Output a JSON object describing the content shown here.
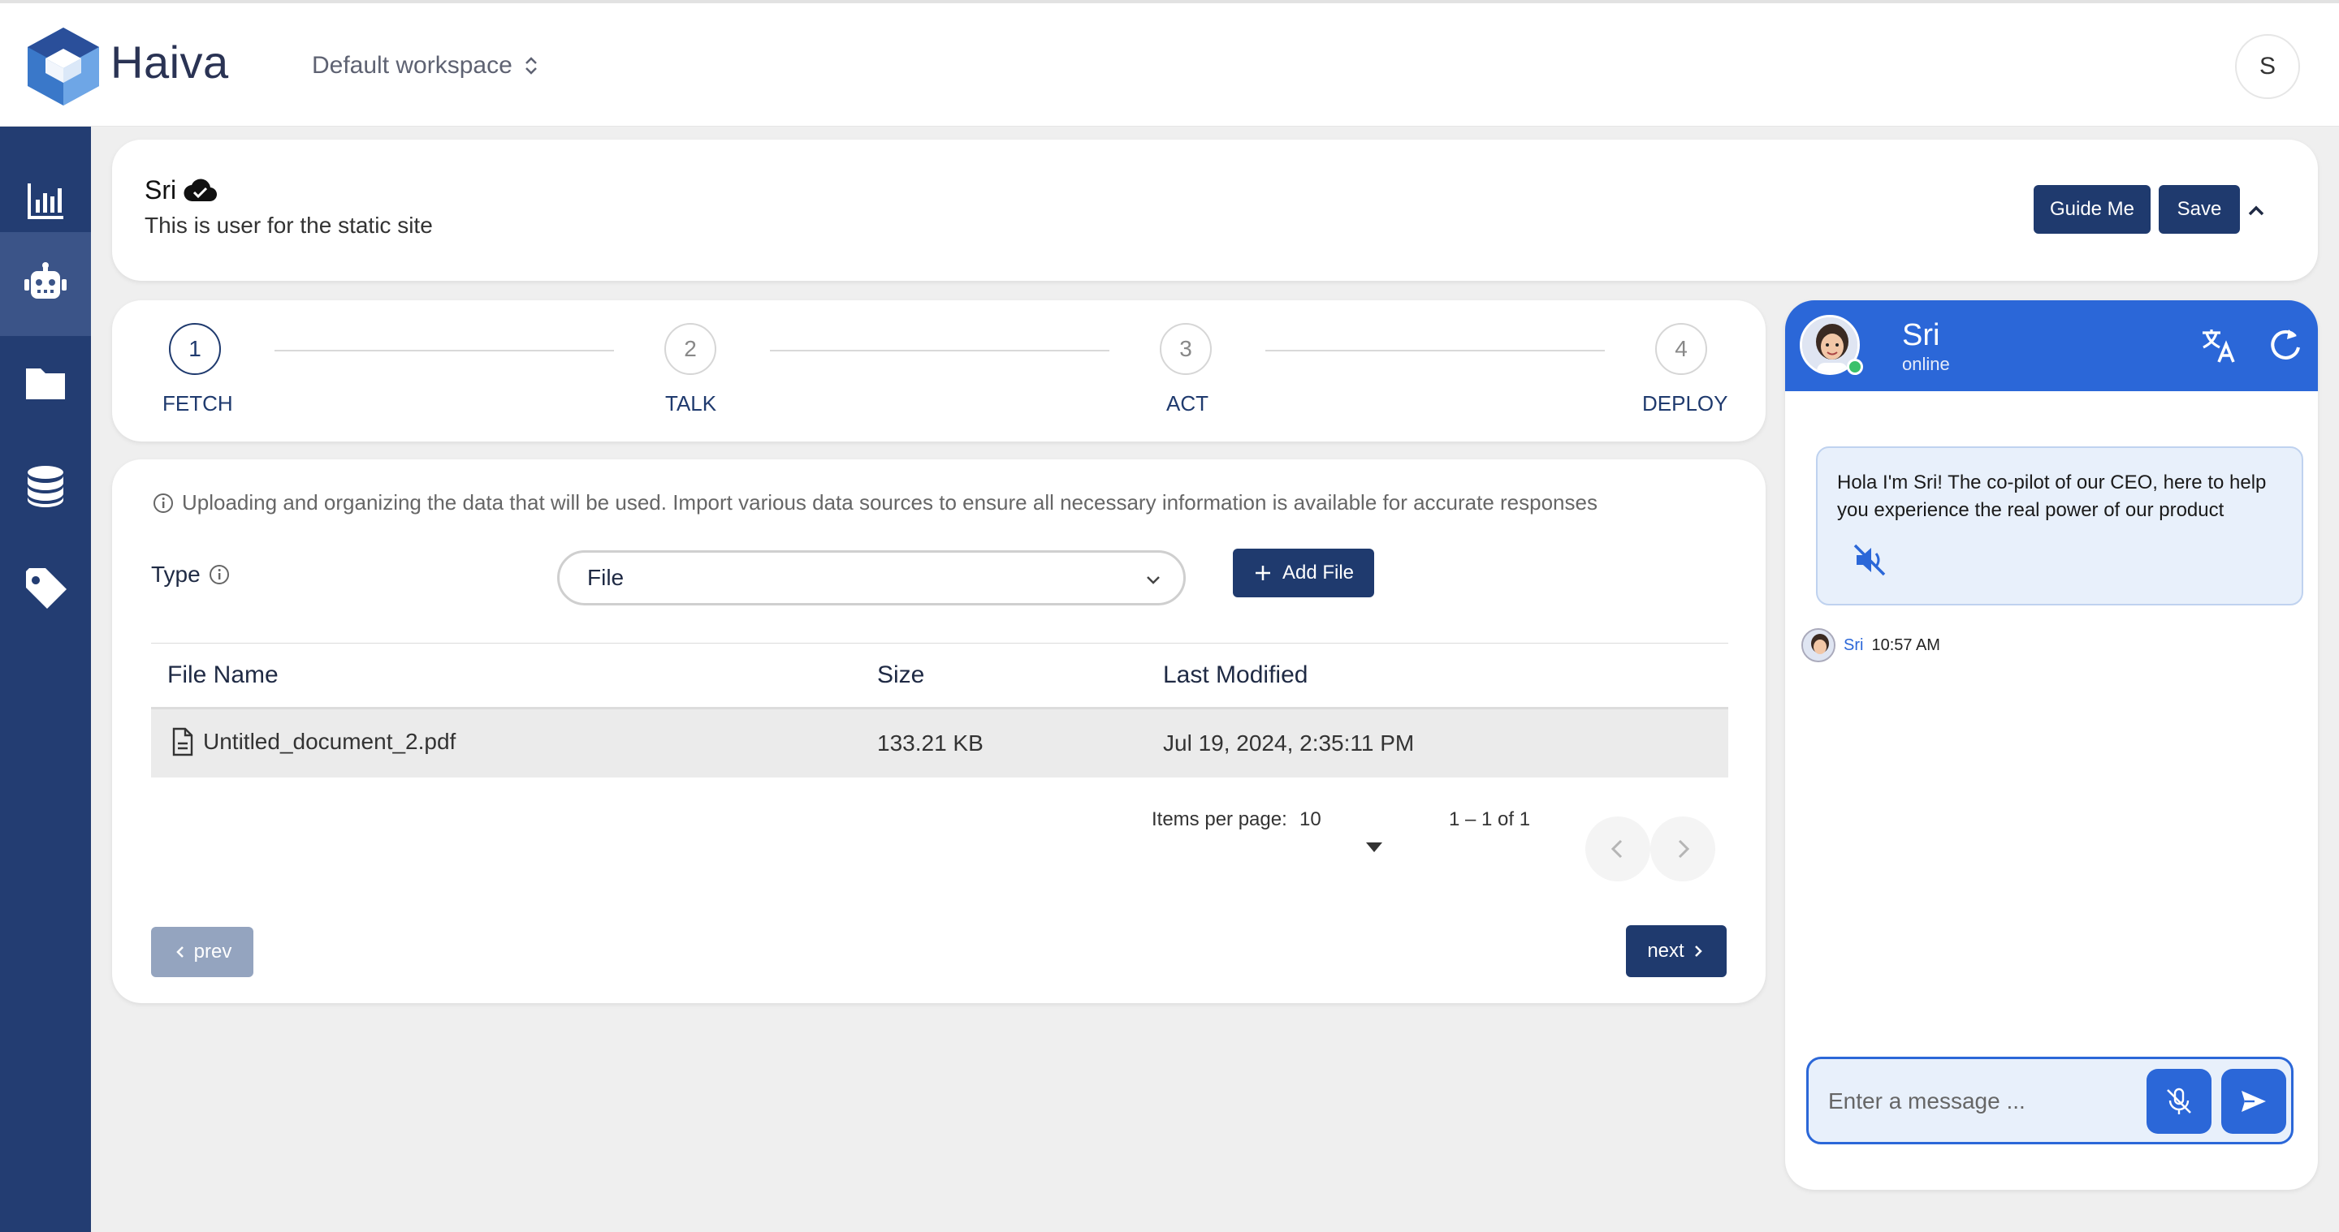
{
  "app": {
    "brand": "Haiva",
    "workspace": "Default workspace",
    "user_initial": "S"
  },
  "sidebar": {
    "items": [
      {
        "icon": "analytics-icon"
      },
      {
        "icon": "robot-icon",
        "active": true
      },
      {
        "icon": "folder-icon"
      },
      {
        "icon": "database-icon"
      },
      {
        "icon": "tag-icon"
      }
    ]
  },
  "header": {
    "title": "Sri",
    "description": "This is user for the static site",
    "guide_label": "Guide Me",
    "save_label": "Save"
  },
  "stepper": {
    "steps": [
      {
        "number": "1",
        "label": "FETCH",
        "active": true
      },
      {
        "number": "2",
        "label": "TALK"
      },
      {
        "number": "3",
        "label": "ACT"
      },
      {
        "number": "4",
        "label": "DEPLOY"
      }
    ]
  },
  "main": {
    "info": "Uploading and organizing the data that will be used. Import various data sources to ensure all necessary information is available for accurate responses",
    "type_label": "Type",
    "type_value": "File",
    "add_file_label": "Add File",
    "table": {
      "headers": [
        "File Name",
        "Size",
        "Last Modified"
      ],
      "rows": [
        {
          "name": "Untitled_document_2.pdf",
          "size": "133.21 KB",
          "modified": "Jul 19, 2024, 2:35:11 PM"
        }
      ]
    },
    "pagination": {
      "items_per_page_label": "Items per page:",
      "items_per_page": "10",
      "range": "1 – 1 of 1"
    },
    "prev_label": "prev",
    "next_label": "next"
  },
  "chat": {
    "name": "Sri",
    "status": "online",
    "message": "Hola I'm Sri! The co-pilot of our CEO, here to help you experience the real power of our product",
    "sender": "Sri",
    "time": "10:57 AM",
    "input_placeholder": "Enter a message ..."
  },
  "colors": {
    "sidebar": "#233d72",
    "primary_button": "#1f3a6e",
    "chat_accent": "#2b67d8",
    "disabled_button": "#94a4bf"
  }
}
